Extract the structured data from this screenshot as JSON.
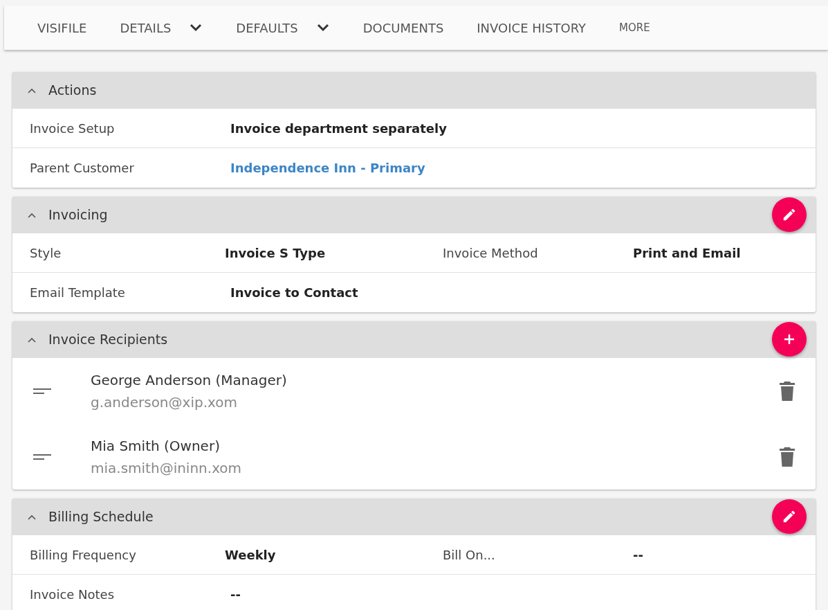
{
  "nav": [
    {
      "label": "VISIFILE",
      "has_menu": false,
      "small": false
    },
    {
      "label": "DETAILS",
      "has_menu": true,
      "small": false
    },
    {
      "label": "DEFAULTS",
      "has_menu": true,
      "small": false
    },
    {
      "label": "DOCUMENTS",
      "has_menu": false,
      "small": false
    },
    {
      "label": "INVOICE HISTORY",
      "has_menu": false,
      "small": false
    },
    {
      "label": "MORE",
      "has_menu": false,
      "small": true
    }
  ],
  "sections": [
    {
      "title": "Actions",
      "expanded": true,
      "has_edit_button": false,
      "has_add_button": false,
      "kind": "fields",
      "rows": [
        [
          {
            "label": "Invoice Setup",
            "value": "Invoice department separately",
            "link": false
          }
        ],
        [
          {
            "label": "Parent Customer",
            "value": "Independence Inn - Primary",
            "link": true
          }
        ]
      ]
    },
    {
      "title": "Invoicing",
      "expanded": true,
      "has_edit_button": true,
      "has_add_button": false,
      "kind": "fields",
      "rows": [
        [
          {
            "label": "Style",
            "value": "Invoice S Type",
            "link": false
          },
          {
            "label": "Invoice Method",
            "value": "Print and Email",
            "link": false
          }
        ],
        [
          {
            "label": "Email Template",
            "value": "Invoice to Contact",
            "link": false
          }
        ]
      ]
    },
    {
      "title": "Invoice Recipients",
      "expanded": true,
      "has_edit_button": false,
      "has_add_button": true,
      "kind": "recipients",
      "recipients": [
        {
          "name": "George Anderson (Manager)",
          "email": "g.anderson@xip.xom"
        },
        {
          "name": "Mia Smith (Owner)",
          "email": "mia.smith@ininn.xom"
        }
      ]
    },
    {
      "title": "Billing Schedule",
      "expanded": true,
      "has_edit_button": true,
      "has_add_button": false,
      "kind": "fields",
      "rows": [
        [
          {
            "label": "Billing Frequency",
            "value": "Weekly",
            "link": false
          },
          {
            "label": "Bill On...",
            "value": "--",
            "link": false
          }
        ],
        [
          {
            "label": "Invoice Notes",
            "value": "--",
            "link": false
          }
        ]
      ]
    }
  ]
}
